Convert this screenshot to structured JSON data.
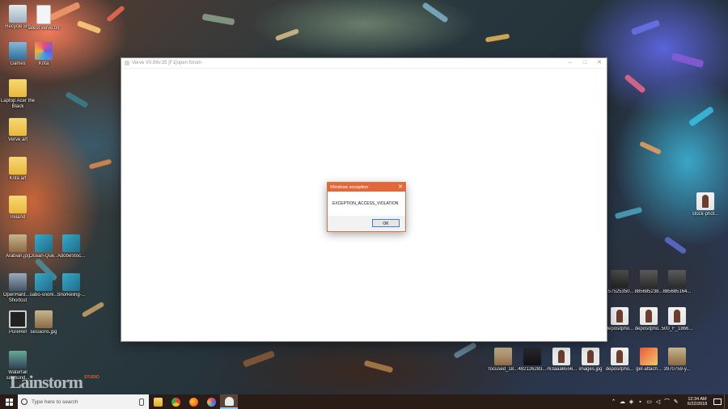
{
  "window": {
    "title": "Verve V0.99v.35 [F1]open forum",
    "minimize": "–",
    "maximize": "□",
    "close": "✕"
  },
  "dialog": {
    "title": "Windows exception",
    "message": "EXCEPTION_ACCESS_VIOLATION",
    "ok_label": "OK",
    "close": "✕"
  },
  "desktop_left": [
    {
      "label": "Recycle Bin",
      "icon": "recycle-bin-icon"
    },
    {
      "label": "latest verve.txt",
      "icon": "text-file-icon"
    },
    {
      "label": "Games",
      "icon": "games-icon"
    },
    {
      "label": "Krita",
      "icon": "krita-icon"
    },
    {
      "label": "Laptop Acer the Black",
      "icon": "folder-icon"
    },
    {
      "label": "Verve art",
      "icon": "folder-icon"
    },
    {
      "label": "Krita art",
      "icon": "folder-icon"
    },
    {
      "label": "Ireland",
      "icon": "folder-icon"
    },
    {
      "label": "Arabian.jpg",
      "icon": "image-icon"
    },
    {
      "label": "Ocean-Que...",
      "icon": "image-icon"
    },
    {
      "label": "AdobeStoc...",
      "icon": "image-icon"
    },
    {
      "label": "OpenHard... - Shortcut",
      "icon": "shortcut-icon"
    },
    {
      "label": "cabo-snork...",
      "icon": "image-icon"
    },
    {
      "label": "Snorkeling-...",
      "icon": "image-icon"
    },
    {
      "label": "PureRef",
      "icon": "pureref-icon"
    },
    {
      "label": "sessions.jpg",
      "icon": "image-icon"
    },
    {
      "label": "Waterfall surround...",
      "icon": "image-icon"
    }
  ],
  "desktop_right": [
    {
      "label": "stock-phot...",
      "icon": "image-icon"
    },
    {
      "label": "157525350...",
      "icon": "image-icon"
    },
    {
      "label": "885685238...",
      "icon": "image-icon"
    },
    {
      "label": "885685164...",
      "icon": "image-icon"
    },
    {
      "label": "depositpho...",
      "icon": "image-icon"
    },
    {
      "label": "depositpho...",
      "icon": "image-icon"
    },
    {
      "label": "500_F_1866...",
      "icon": "image-icon"
    }
  ],
  "desktop_bottom": [
    {
      "label": "focused_18...",
      "icon": "image-icon"
    },
    {
      "label": "482126283...",
      "icon": "image-icon"
    },
    {
      "label": "763aaa6556...",
      "icon": "image-icon"
    },
    {
      "label": "images.jpg",
      "icon": "image-icon"
    },
    {
      "label": "depositpho...",
      "icon": "image-icon"
    },
    {
      "label": "get-attach...",
      "icon": "image-icon"
    },
    {
      "label": "3970759-y...",
      "icon": "image-icon"
    }
  ],
  "watermark": {
    "text": "Lainstorm",
    "sub": "STUDIO"
  },
  "taskbar": {
    "search_placeholder": "Type here to search",
    "time": "12:34 AM",
    "date": "6/22/2018",
    "tray_chevron": "⌃",
    "tray_lang": "ENG"
  }
}
